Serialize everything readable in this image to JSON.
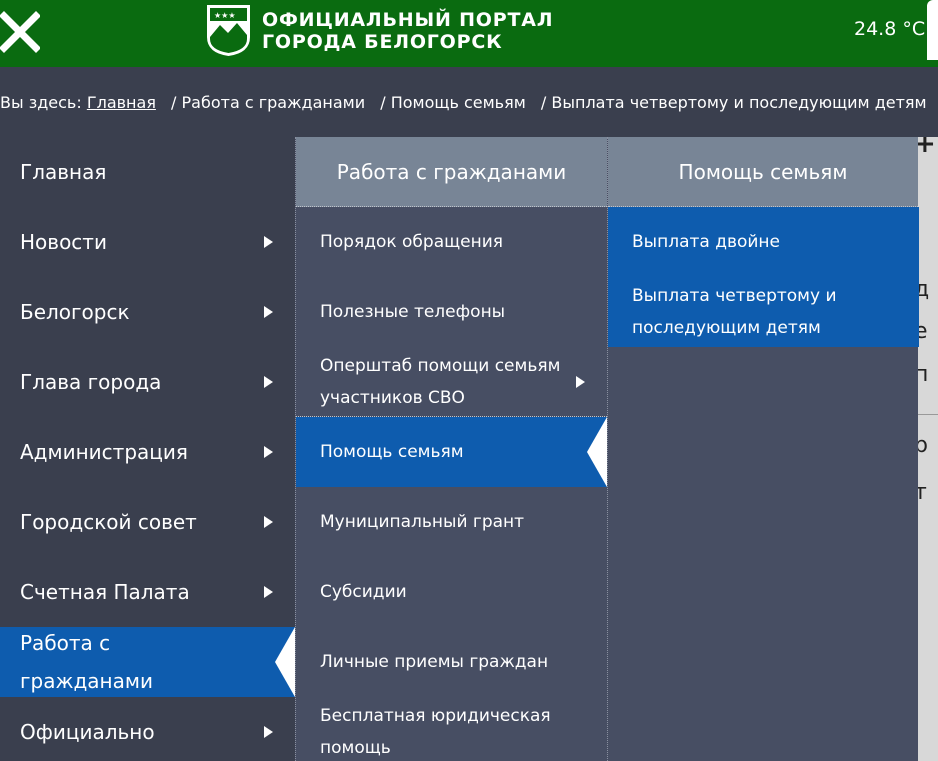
{
  "header": {
    "title_line1": "ОФИЦИАЛЬНЫЙ ПОРТАЛ",
    "title_line2": "ГОРОДА БЕЛОГОРСК",
    "temperature": "24.8 °C",
    "colors": {
      "header_bg": "#0a6b10",
      "active": "#0e5cae",
      "menu_bg": "#3a3f4e",
      "submenu_bg": "#474e63",
      "submenu_header": "#788596"
    }
  },
  "breadcrumb": {
    "prefix": "Вы здесь:",
    "home": "Главная",
    "items": [
      "Работа с гражданами",
      "Помощь семьям",
      "Выплата четвертому и последующим детям"
    ]
  },
  "menu": {
    "items": [
      {
        "label": "Главная"
      },
      {
        "label": "Новости"
      },
      {
        "label": "Белогорск"
      },
      {
        "label": "Глава города"
      },
      {
        "label": "Администрация"
      },
      {
        "label": "Городской совет"
      },
      {
        "label": "Счетная Палата"
      },
      {
        "label": "Работа с гражданами"
      },
      {
        "label": "Официально"
      }
    ]
  },
  "submenu": {
    "title": "Работа с гражданами",
    "items": [
      {
        "label": "Порядок обращения"
      },
      {
        "label": "Полезные телефоны"
      },
      {
        "label": "Оперштаб помощи семьям участников СВО"
      },
      {
        "label": "Помощь семьям"
      },
      {
        "label": "Муниципальный грант"
      },
      {
        "label": "Субсидии"
      },
      {
        "label": "Личные приемы граждан"
      },
      {
        "label": "Бесплатная юридическая помощь"
      }
    ]
  },
  "subsubmenu": {
    "title": "Помощь семьям",
    "items": [
      {
        "label": "Выплата двойне"
      },
      {
        "label": "Выплата четвертому и последующим детям"
      }
    ]
  }
}
